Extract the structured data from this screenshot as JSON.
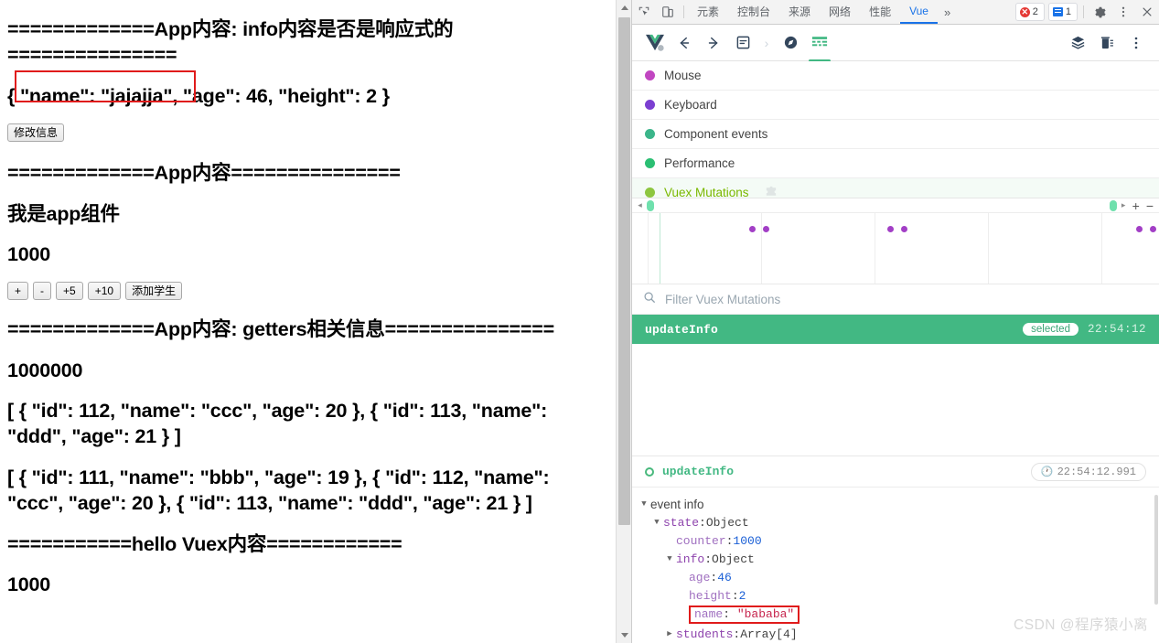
{
  "page": {
    "lines": [
      "=============App内容: info内容是否是响应式的===============",
      "{ \"name\": \"jajajja\", \"age\": 46, \"height\": 2 }",
      "=============App内容===============",
      "我是app组件",
      "1000",
      "=============App内容: getters相关信息===============",
      "1000000",
      "[ { \"id\": 112, \"name\": \"ccc\", \"age\": 20 }, { \"id\": 113, \"name\": \"ddd\", \"age\": 21 } ]",
      "[ { \"id\": 111, \"name\": \"bbb\", \"age\": 19 }, { \"id\": 112, \"name\": \"ccc\", \"age\": 20 }, { \"id\": 113, \"name\": \"ddd\", \"age\": 21 } ]",
      "===========hello Vuex内容============",
      "1000"
    ],
    "modify_button": "修改信息",
    "counter_buttons": [
      "+",
      "-",
      "+5",
      "+10",
      "添加学生"
    ]
  },
  "devtools": {
    "tabs": [
      {
        "label": "元素",
        "active": false
      },
      {
        "label": "控制台",
        "active": false
      },
      {
        "label": "来源",
        "active": false
      },
      {
        "label": "网络",
        "active": false
      },
      {
        "label": "性能",
        "active": false
      },
      {
        "label": "Vue",
        "active": true
      }
    ],
    "overflow_label": "»",
    "error_count": "2",
    "message_count": "1",
    "icons": {
      "inspect": "inspect-element-icon",
      "device": "device-toolbar-icon",
      "settings": "gear-icon",
      "kebab": "more-options-icon",
      "close": "close-icon"
    }
  },
  "vue_toolbar": {
    "logo": "vue-logo-icon",
    "back": "back-arrow-icon",
    "forward": "forward-arrow-icon",
    "components": "components-icon",
    "router": "router-compass-icon",
    "timeline": "timeline-icon",
    "layers": "layers-icon",
    "clear": "clear-trash-icon",
    "menu": "more-options-icon"
  },
  "layers": {
    "items": [
      {
        "label": "Mouse",
        "color": "#c146c1",
        "selected": false,
        "tag": ""
      },
      {
        "label": "Keyboard",
        "color": "#7b3fd1",
        "selected": false,
        "tag": ""
      },
      {
        "label": "Component events",
        "color": "#3bb58a",
        "selected": false,
        "tag": ""
      },
      {
        "label": "Performance",
        "color": "#2bbf73",
        "selected": false,
        "tag": ""
      },
      {
        "label": "Vuex Mutations",
        "color": "#8dc63f",
        "selected": true,
        "tag": "puzzle-piece-icon"
      }
    ]
  },
  "timeline": {
    "zoom_in": "+",
    "zoom_out": "−",
    "left_arrow": "◂",
    "right_arrow": "▸",
    "dots_x_percent": [
      23.5,
      30.5,
      57,
      61.5,
      97,
      100
    ],
    "gridlines_percent": [
      3,
      24.5,
      46,
      67.5,
      89
    ]
  },
  "filter": {
    "placeholder": "Filter Vuex Mutations",
    "value": "",
    "icon": "search-icon"
  },
  "events": [
    {
      "name": "updateInfo",
      "badge": "selected",
      "time": "22:54:12",
      "selected": true
    }
  ],
  "inspector": {
    "title": "updateInfo",
    "timestamp": "22:54:12.991",
    "clock_icon": "clock-icon",
    "root_label": "event info",
    "tree": [
      {
        "indent": 1,
        "arrow": "▼",
        "key": "state",
        "sep": ": ",
        "value": "Object",
        "value_kind": "type",
        "key_kind": "prop",
        "boxed": false
      },
      {
        "indent": 2,
        "arrow": "",
        "key": "counter",
        "sep": ": ",
        "value": "1000",
        "value_kind": "num",
        "key_kind": "prop2",
        "boxed": false
      },
      {
        "indent": 2,
        "arrow": "▼",
        "key": "info",
        "sep": ": ",
        "value": "Object",
        "value_kind": "type",
        "key_kind": "prop",
        "boxed": false
      },
      {
        "indent": 3,
        "arrow": "",
        "key": "age",
        "sep": ": ",
        "value": "46",
        "value_kind": "num",
        "key_kind": "prop2",
        "boxed": false
      },
      {
        "indent": 3,
        "arrow": "",
        "key": "height",
        "sep": ": ",
        "value": "2",
        "value_kind": "num",
        "key_kind": "prop2",
        "boxed": false
      },
      {
        "indent": 3,
        "arrow": "",
        "key": "name",
        "sep": ": ",
        "value": "\"bababa\"",
        "value_kind": "str",
        "key_kind": "prop2",
        "boxed": true
      },
      {
        "indent": 2,
        "arrow": "▶",
        "key": "students",
        "sep": ": ",
        "value": "Array[4]",
        "value_kind": "type",
        "key_kind": "prop",
        "boxed": false
      }
    ]
  },
  "watermark": "CSDN @程序猿小离",
  "colors": {
    "vue_green": "#42b883",
    "accent_blue": "#1a73e8",
    "highlight_red": "#e01b1b",
    "mutation_purple": "#a23fc6"
  }
}
